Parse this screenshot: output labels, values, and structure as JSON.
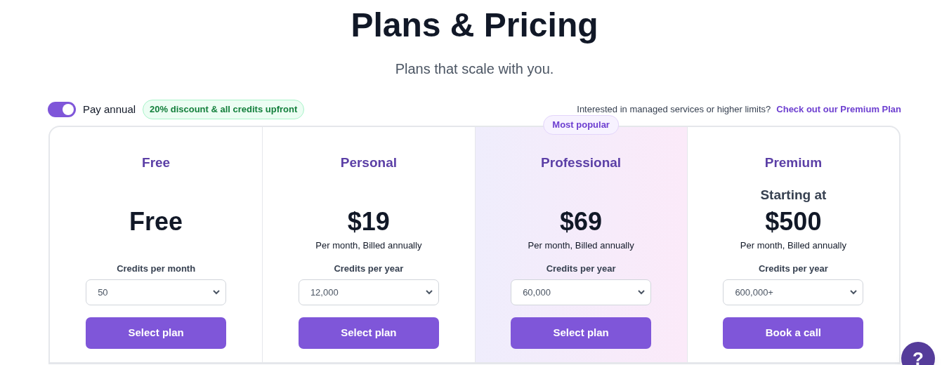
{
  "header": {
    "title": "Plans & Pricing",
    "subtitle": "Plans that scale with you."
  },
  "billing": {
    "toggle": {
      "on": true
    },
    "label": "Pay annual",
    "badge": "20% discount & all credits upfront"
  },
  "premium_note": {
    "text": "Interested in managed services or higher limits?",
    "link": "Check out our Premium Plan"
  },
  "plans": [
    {
      "name": "Free",
      "price": "Free",
      "credits_label": "Credits per month",
      "credits": "50",
      "button": "Select plan",
      "highlighted": false
    },
    {
      "name": "Personal",
      "price": "$19",
      "note": "Per month, Billed annually",
      "credits_label": "Credits per year",
      "credits": "12,000",
      "button": "Select plan",
      "highlighted": false
    },
    {
      "name": "Professional",
      "badge": "Most popular",
      "price": "$69",
      "note": "Per month, Billed annually",
      "credits_label": "Credits per year",
      "credits": "60,000",
      "button": "Select plan",
      "highlighted": true
    },
    {
      "name": "Premium",
      "prefix": "Starting at",
      "price": "$500",
      "note": "Per month, Billed annually",
      "credits_label": "Credits per year",
      "credits": "600,000+",
      "button": "Book a call",
      "highlighted": false
    }
  ],
  "help_button": "?"
}
